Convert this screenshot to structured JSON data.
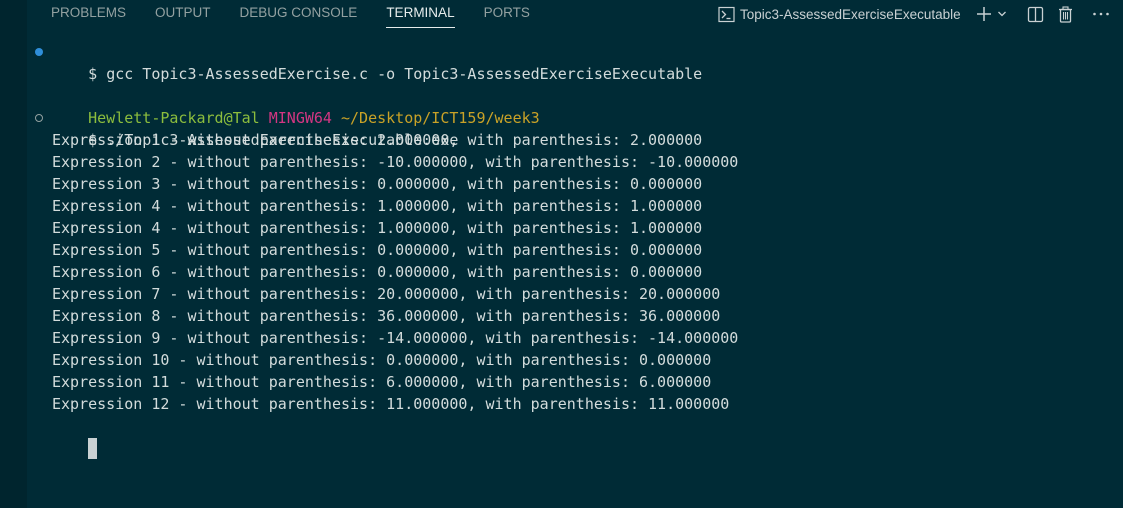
{
  "tabs": [
    {
      "label": "PROBLEMS",
      "active": false
    },
    {
      "label": "OUTPUT",
      "active": false
    },
    {
      "label": "DEBUG CONSOLE",
      "active": false
    },
    {
      "label": "TERMINAL",
      "active": true
    },
    {
      "label": "PORTS",
      "active": false
    }
  ],
  "terminal_instance": {
    "name": "Topic3-AssessedExerciseExecutable",
    "icon": "terminal-icon"
  },
  "actions": {
    "new_terminal_icon": "plus-icon",
    "dropdown_icon": "chevron-down-icon",
    "split_icon": "split-terminal-icon",
    "kill_icon": "trash-icon",
    "more_icon": "ellipsis-icon"
  },
  "terminal": {
    "command1": {
      "decoration": "success",
      "prompt": "$",
      "text": "gcc Topic3-AssessedExercise.c -o Topic3-AssessedExerciseExecutable"
    },
    "prompt_header": {
      "user_host": "Hewlett-Packard@Tal",
      "system": "MINGW64",
      "path": "~/Desktop/ICT159/week3"
    },
    "command2": {
      "decoration": "pending",
      "prompt": "$",
      "text": "./Topic3-AssessedExerciseExecutable.exe"
    },
    "output": [
      "Expression 1 - without parenthesis: 2.000000, with parenthesis: 2.000000",
      "Expression 2 - without parenthesis: -10.000000, with parenthesis: -10.000000",
      "Expression 3 - without parenthesis: 0.000000, with parenthesis: 0.000000",
      "Expression 4 - without parenthesis: 1.000000, with parenthesis: 1.000000",
      "Expression 4 - without parenthesis: 1.000000, with parenthesis: 1.000000",
      "Expression 5 - without parenthesis: 0.000000, with parenthesis: 0.000000",
      "Expression 6 - without parenthesis: 0.000000, with parenthesis: 0.000000",
      "Expression 7 - without parenthesis: 20.000000, with parenthesis: 20.000000",
      "Expression 8 - without parenthesis: 36.000000, with parenthesis: 36.000000",
      "Expression 9 - without parenthesis: -14.000000, with parenthesis: -14.000000",
      "Expression 10 - without parenthesis: 0.000000, with parenthesis: 0.000000",
      "Expression 11 - without parenthesis: 6.000000, with parenthesis: 6.000000",
      "Expression 12 - without parenthesis: 11.000000, with parenthesis: 11.000000"
    ]
  },
  "colors": {
    "background": "#002b36",
    "user_host": "#8cbd3d",
    "system": "#d33682",
    "path": "#c9a227",
    "success_decoration": "#2f8ed9"
  }
}
